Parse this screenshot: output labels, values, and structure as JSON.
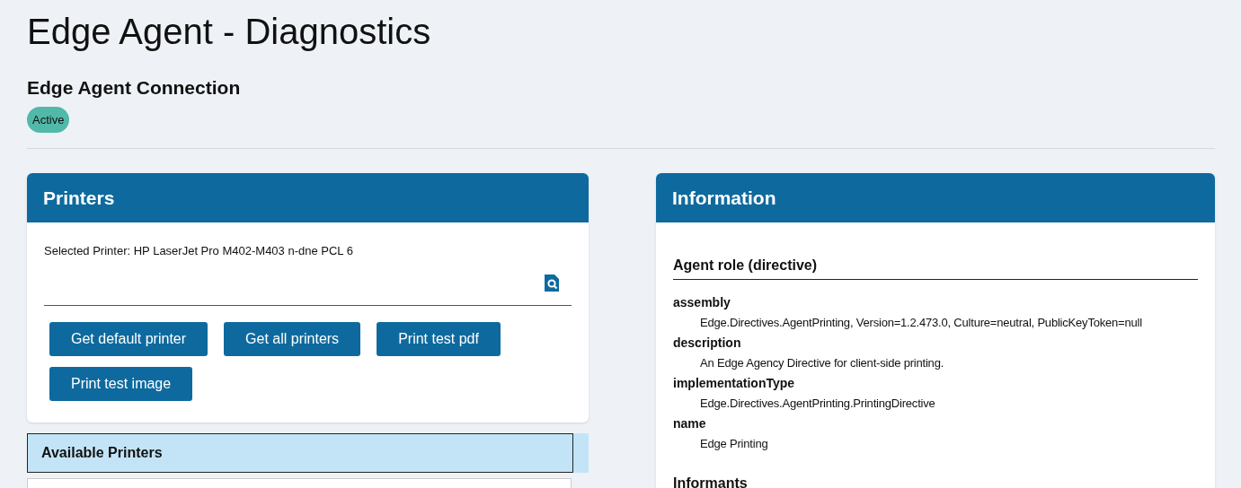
{
  "page_title": "Edge Agent - Diagnostics",
  "connection": {
    "heading": "Edge Agent Connection",
    "status": {
      "label": "Active",
      "active": true
    }
  },
  "printers": {
    "title": "Printers",
    "selected_printer": "Selected Printer: HP LaserJet Pro M402-M403 n-dne PCL 6",
    "buttons": [
      "Get default printer",
      "Get all printers",
      "Print test pdf",
      "Print test image"
    ],
    "available": {
      "title": "Available Printers"
    }
  },
  "information": {
    "title": "Information",
    "section": "Agent role (directive)",
    "properties": [
      {
        "key": "assembly",
        "value": "Edge.Directives.AgentPrinting, Version=1.2.473.0, Culture=neutral, PublicKeyToken=null"
      },
      {
        "key": "description",
        "value": "An Edge Agency Directive for client-side printing."
      },
      {
        "key": "implementationType",
        "value": "Edge.Directives.AgentPrinting.PrintingDirective"
      },
      {
        "key": "name",
        "value": "Edge Printing"
      }
    ],
    "next_section": "Informants"
  }
}
